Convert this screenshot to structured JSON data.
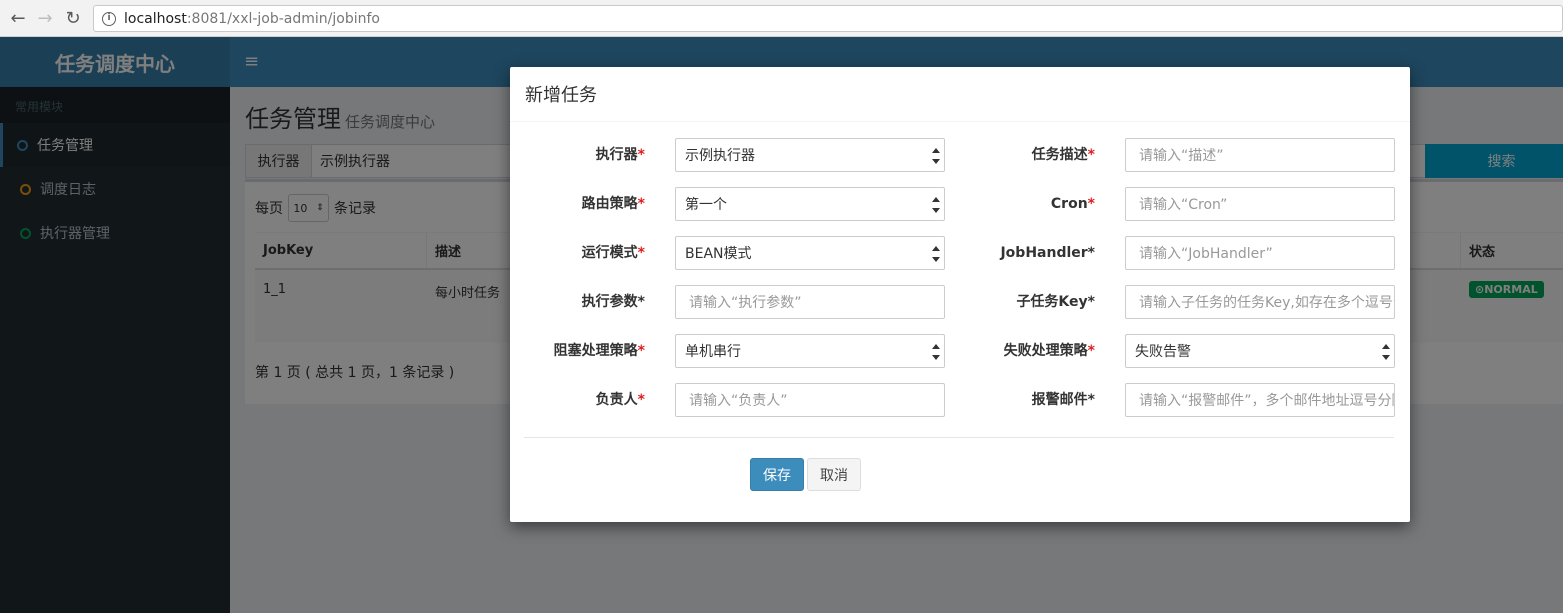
{
  "browser": {
    "back_icon": "←",
    "forward_icon": "→",
    "reload_icon": "↻",
    "url_host": "localhost",
    "url_rest": ":8081/xxl-job-admin/jobinfo"
  },
  "sidebar": {
    "logo": "任务调度中心",
    "header": "常用模块",
    "items": [
      {
        "label": "任务管理",
        "color": "#3c8dbc",
        "active": true
      },
      {
        "label": "调度日志",
        "color": "#f39c12",
        "active": false
      },
      {
        "label": "执行器管理",
        "color": "#00a65a",
        "active": false
      }
    ]
  },
  "topbar": {
    "menu_icon": "≡"
  },
  "page": {
    "title": "任务管理",
    "subtitle": "任务调度中心",
    "filter_label": "执行器",
    "filter_value": "示例执行器",
    "search_label": "搜索",
    "per_page_prefix": "每页",
    "per_page_value": "10",
    "per_page_suffix": "条记录",
    "table": {
      "headers": [
        "JobKey",
        "描述",
        "状态"
      ],
      "row": {
        "jobkey": "1_1",
        "desc": "每小时任务",
        "status": "NORMAL"
      }
    },
    "pager": "第 1 页 ( 总共 1 页，1 条记录 )"
  },
  "modal": {
    "title": "新增任务",
    "fields_left": [
      {
        "label": "执行器",
        "value": "示例执行器",
        "type": "select"
      },
      {
        "label": "路由策略",
        "value": "第一个",
        "type": "select"
      },
      {
        "label": "运行模式",
        "value": "BEAN模式",
        "type": "select"
      },
      {
        "label": "执行参数",
        "placeholder": "请输入“执行参数”",
        "type": "input",
        "req_black": true
      },
      {
        "label": "阻塞处理策略",
        "value": "单机串行",
        "type": "select"
      },
      {
        "label": "负责人",
        "placeholder": "请输入“负责人”",
        "type": "input"
      }
    ],
    "fields_right": [
      {
        "label": "任务描述",
        "placeholder": "请输入“描述”",
        "type": "input"
      },
      {
        "label": "Cron",
        "placeholder": "请输入“Cron”",
        "type": "input"
      },
      {
        "label": "JobHandler",
        "placeholder": "请输入“JobHandler”",
        "type": "input",
        "req_black": true
      },
      {
        "label": "子任务Key",
        "placeholder": "请输入子任务的任务Key,如存在多个逗号分隔",
        "type": "input",
        "req_black": true
      },
      {
        "label": "失败处理策略",
        "value": "失败告警",
        "type": "select"
      },
      {
        "label": "报警邮件",
        "placeholder": "请输入“报警邮件”，多个邮件地址逗号分隔",
        "type": "input",
        "req_black": true
      }
    ],
    "required_mark": "*",
    "save_label": "保存",
    "cancel_label": "取消"
  }
}
